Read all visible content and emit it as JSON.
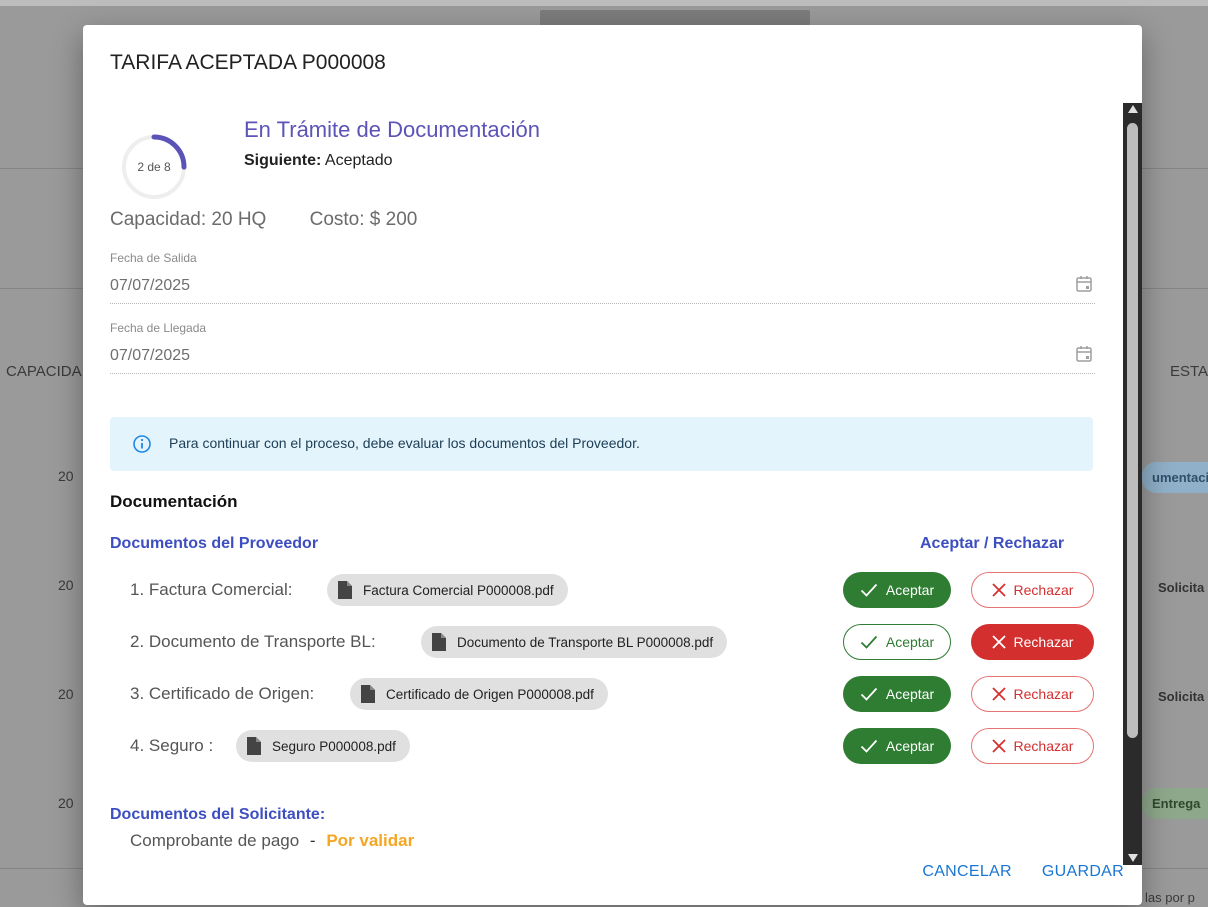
{
  "background": {
    "column_left": "CAPACIDA",
    "column_right": "ESTA",
    "capacity_values": [
      "20",
      "20",
      "20",
      "20"
    ],
    "status_chips": [
      {
        "label": "umentaci",
        "color": "#8fb0c8"
      },
      {
        "label": "Solicita",
        "color": "#9a9a9a"
      },
      {
        "label": "Solicita",
        "color": "#9a9a9a"
      },
      {
        "label": "Entrega",
        "color": "#8ea88c"
      }
    ],
    "footer_text": "las por p"
  },
  "dialog": {
    "title": "TARIFA ACEPTADA P000008",
    "progress": {
      "label": "2 de 8",
      "current": 2,
      "total": 8
    },
    "status_title": "En Trámite de Documentación",
    "next_label": "Siguiente:",
    "next_value": "Aceptado",
    "capacity": "Capacidad: 20 HQ",
    "cost": "Costo: $ 200",
    "fecha_salida": {
      "label": "Fecha de Salida",
      "value": "07/07/2025"
    },
    "fecha_llegada": {
      "label": "Fecha de Llegada",
      "value": "07/07/2025"
    },
    "alert": "Para continuar con el proceso, debe evaluar los documentos del Proveedor.",
    "section_title": "Documentación",
    "provider_title": "Documentos del Proveedor",
    "accept_reject_title": "Aceptar / Rechazar",
    "accept_label": "Aceptar",
    "reject_label": "Rechazar",
    "documents": [
      {
        "label": "1. Factura Comercial:",
        "file": "Factura Comercial P000008.pdf",
        "state": "accepted"
      },
      {
        "label": "2. Documento de Transporte BL:",
        "file": "Documento de Transporte BL P000008.pdf",
        "state": "rejected"
      },
      {
        "label": "3. Certificado de Origen:",
        "file": "Certificado de Origen P000008.pdf",
        "state": "accepted"
      },
      {
        "label": "4. Seguro :",
        "file": "Seguro P000008.pdf",
        "state": "accepted"
      }
    ],
    "requester_title": "Documentos del Solicitante:",
    "payment_label": "Comprobante de pago",
    "payment_sep": "-",
    "payment_status": "Por validar",
    "cancel_label": "CANCELAR",
    "save_label": "GUARDAR"
  },
  "colors": {
    "accent": "#5c53b8",
    "link": "#3d4fc0",
    "accept": "#2e7d32",
    "reject": "#d32f2f",
    "pending": "#f5a623",
    "action": "#1976d2"
  }
}
